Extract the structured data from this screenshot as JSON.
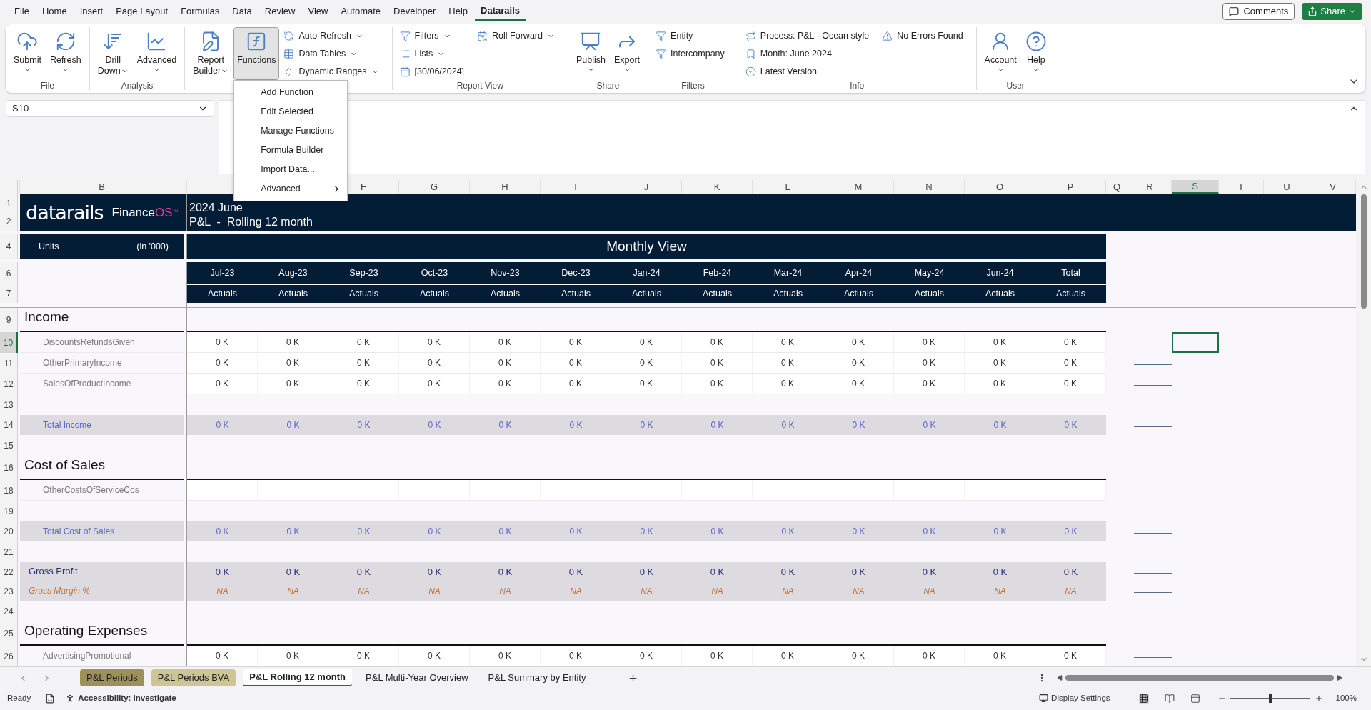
{
  "menu_tabs": [
    {
      "label": "File",
      "selected": false
    },
    {
      "label": "Home",
      "selected": false
    },
    {
      "label": "Insert",
      "selected": false
    },
    {
      "label": "Page Layout",
      "selected": false
    },
    {
      "label": "Formulas",
      "selected": false
    },
    {
      "label": "Data",
      "selected": false
    },
    {
      "label": "Review",
      "selected": false
    },
    {
      "label": "View",
      "selected": false
    },
    {
      "label": "Automate",
      "selected": false
    },
    {
      "label": "Developer",
      "selected": false
    },
    {
      "label": "Help",
      "selected": false
    },
    {
      "label": "Datarails",
      "selected": true
    }
  ],
  "top_buttons": {
    "comments": "Comments",
    "share": "Share"
  },
  "ribbon": {
    "groups": [
      {
        "label": "File",
        "items": [
          {
            "kind": "large",
            "lines": [
              "Submit"
            ],
            "dropdown": true,
            "pressed": false
          },
          {
            "kind": "large",
            "lines": [
              "Refresh"
            ],
            "dropdown": true,
            "pressed": false
          }
        ]
      },
      {
        "label": "Analysis",
        "items": [
          {
            "kind": "large",
            "lines": [
              "Drill",
              "Down"
            ],
            "dropdown": true,
            "pressed": false
          },
          {
            "kind": "large",
            "lines": [
              "Advanced"
            ],
            "dropdown": true,
            "pressed": false
          }
        ]
      },
      {
        "items": [
          {
            "kind": "large",
            "lines": [
              "Report",
              "Builder"
            ],
            "dropdown": true,
            "pressed": false
          },
          {
            "kind": "large",
            "lines": [
              "Functions"
            ],
            "dropdown": false,
            "pressed": true
          },
          {
            "kind": "column",
            "entries": [
              {
                "label": "Auto-Refresh",
                "dropdown": true
              },
              {
                "label": "Data Tables",
                "dropdown": true
              },
              {
                "label": "Dynamic Ranges",
                "dropdown": true
              }
            ]
          }
        ]
      },
      {
        "label": "Report View",
        "items": [
          {
            "kind": "column",
            "entries": [
              {
                "label": "Filters",
                "dropdown": true
              },
              {
                "label": "Lists",
                "dropdown": true
              },
              {
                "label": "[30/06/2024]",
                "dropdown": false
              }
            ]
          },
          {
            "kind": "column",
            "entries": [
              {
                "label": "Roll Forward",
                "dropdown": true
              }
            ]
          }
        ]
      },
      {
        "label": "Share",
        "items": [
          {
            "kind": "large",
            "lines": [
              "Publish"
            ],
            "dropdown": true,
            "pressed": false
          },
          {
            "kind": "large",
            "lines": [
              "Export"
            ],
            "dropdown": true,
            "pressed": false
          }
        ]
      },
      {
        "label": "Filters",
        "items": [
          {
            "kind": "column",
            "entries": [
              {
                "label": "Entity",
                "dropdown": false
              },
              {
                "label": "Intercompany",
                "dropdown": false
              }
            ]
          }
        ]
      },
      {
        "label": "Info",
        "items": [
          {
            "kind": "column",
            "entries": [
              {
                "label": "Process: P&L - Ocean style",
                "dropdown": false
              },
              {
                "label": "Month: June 2024",
                "dropdown": false
              },
              {
                "label": "Latest Version",
                "dropdown": false
              }
            ]
          },
          {
            "kind": "column",
            "entries": [
              {
                "label": "No Errors Found",
                "dropdown": false
              }
            ]
          }
        ]
      },
      {
        "label": "User",
        "items": [
          {
            "kind": "large",
            "lines": [
              "Account"
            ],
            "dropdown": true,
            "pressed": false
          },
          {
            "kind": "large",
            "lines": [
              "Help"
            ],
            "dropdown": true,
            "pressed": false
          }
        ]
      }
    ]
  },
  "functions_menu": [
    {
      "label": "Add Function",
      "submenu": false
    },
    {
      "label": "Edit Selected",
      "submenu": false
    },
    {
      "label": "Manage Functions",
      "submenu": false
    },
    {
      "label": "Formula Builder",
      "submenu": false
    },
    {
      "label": "Import Data...",
      "submenu": false
    },
    {
      "label": "Advanced",
      "submenu": true
    }
  ],
  "name_box": "S10",
  "sheet": {
    "columns": [
      {},
      {
        "label": "B",
        "selected": false
      },
      {},
      {},
      {},
      {
        "label": "F",
        "selected": false
      },
      {
        "label": "G",
        "selected": false
      },
      {
        "label": "H",
        "selected": false
      },
      {
        "label": "I",
        "selected": false
      },
      {
        "label": "J",
        "selected": false
      },
      {
        "label": "K",
        "selected": false
      },
      {
        "label": "L",
        "selected": false
      },
      {
        "label": "M",
        "selected": false
      },
      {
        "label": "N",
        "selected": false
      },
      {
        "label": "O",
        "selected": false
      },
      {
        "label": "P",
        "selected": false
      },
      {
        "label": "Q",
        "selected": false
      },
      {
        "label": "R",
        "selected": false
      },
      {
        "label": "S",
        "selected": true
      },
      {
        "label": "T",
        "selected": false
      },
      {
        "label": "U",
        "selected": false
      },
      {
        "label": "V",
        "selected": false
      }
    ],
    "logo": {
      "brand": "datarails",
      "product": "Finance",
      "product_accent": "OS",
      "trademark": "™"
    },
    "title_rows": [
      {
        "number": "1",
        "text": "2024 June"
      },
      {
        "number": "2",
        "text": "P&L  -  Rolling 12 month"
      }
    ],
    "units_row": {
      "number": "4",
      "label": "Units",
      "scale": "(in '000)",
      "title": "Monthly View"
    },
    "period_row": {
      "number": "6",
      "values": [
        "Jul-23",
        "Aug-23",
        "Sep-23",
        "Oct-23",
        "Nov-23",
        "Dec-23",
        "Jan-24",
        "Feb-24",
        "Mar-24",
        "Apr-24",
        "May-24",
        "Jun-24",
        "Total"
      ]
    },
    "scenario_row": {
      "number": "7",
      "values": [
        "Actuals",
        "Actuals",
        "Actuals",
        "Actuals",
        "Actuals",
        "Actuals",
        "Actuals",
        "Actuals",
        "Actuals",
        "Actuals",
        "Actuals",
        "Actuals",
        "Actuals"
      ]
    },
    "rows": [
      {
        "number": "9",
        "kind": "section",
        "label": "Income",
        "selected": false
      },
      {
        "number": "10",
        "kind": "line",
        "label": "DiscountsRefundsGiven",
        "selected": true,
        "marker": true,
        "values": [
          "0 K",
          "0 K",
          "0 K",
          "0 K",
          "0 K",
          "0 K",
          "0 K",
          "0 K",
          "0 K",
          "0 K",
          "0 K",
          "0 K",
          "0 K"
        ]
      },
      {
        "number": "11",
        "kind": "line",
        "label": "OtherPrimaryIncome",
        "selected": false,
        "marker": true,
        "values": [
          "0 K",
          "0 K",
          "0 K",
          "0 K",
          "0 K",
          "0 K",
          "0 K",
          "0 K",
          "0 K",
          "0 K",
          "0 K",
          "0 K",
          "0 K"
        ]
      },
      {
        "number": "12",
        "kind": "line",
        "label": "SalesOfProductIncome",
        "selected": false,
        "marker": true,
        "values": [
          "0 K",
          "0 K",
          "0 K",
          "0 K",
          "0 K",
          "0 K",
          "0 K",
          "0 K",
          "0 K",
          "0 K",
          "0 K",
          "0 K",
          "0 K"
        ]
      },
      {
        "number": "13",
        "kind": "blank",
        "selected": false
      },
      {
        "number": "14",
        "kind": "total",
        "label": "Total Income",
        "selected": false,
        "marker": true,
        "values": [
          "0 K",
          "0 K",
          "0 K",
          "0 K",
          "0 K",
          "0 K",
          "0 K",
          "0 K",
          "0 K",
          "0 K",
          "0 K",
          "0 K",
          "0 K"
        ]
      },
      {
        "number": "15",
        "kind": "blank",
        "selected": false
      },
      {
        "number": "16",
        "kind": "section",
        "label": "Cost of Sales",
        "selected": false
      },
      {
        "number": "18",
        "kind": "line",
        "label": "OtherCostsOfServiceCos",
        "selected": false
      },
      {
        "number": "19",
        "kind": "blank",
        "selected": false
      },
      {
        "number": "20",
        "kind": "total",
        "label": "Total Cost of Sales",
        "selected": false,
        "marker": true,
        "values": [
          "0 K",
          "0 K",
          "0 K",
          "0 K",
          "0 K",
          "0 K",
          "0 K",
          "0 K",
          "0 K",
          "0 K",
          "0 K",
          "0 K",
          "0 K"
        ]
      },
      {
        "number": "21",
        "kind": "blank",
        "selected": false
      },
      {
        "number": "22",
        "kind": "gross",
        "label": "Gross Profit",
        "selected": false,
        "marker": true,
        "values": [
          "0 K",
          "0 K",
          "0 K",
          "0 K",
          "0 K",
          "0 K",
          "0 K",
          "0 K",
          "0 K",
          "0 K",
          "0 K",
          "0 K",
          "0 K"
        ]
      },
      {
        "number": "23",
        "kind": "margin",
        "label": "Gross Margin %",
        "selected": false,
        "marker": true,
        "values": [
          "NA",
          "NA",
          "NA",
          "NA",
          "NA",
          "NA",
          "NA",
          "NA",
          "NA",
          "NA",
          "NA",
          "NA",
          "NA"
        ]
      },
      {
        "number": "24",
        "kind": "blank",
        "selected": false
      },
      {
        "number": "25",
        "kind": "section",
        "label": "Operating Expenses",
        "selected": false
      },
      {
        "number": "26",
        "kind": "line",
        "label": "AdvertisingPromotional",
        "selected": false,
        "marker": true,
        "values": [
          "0 K",
          "0 K",
          "0 K",
          "0 K",
          "0 K",
          "0 K",
          "0 K",
          "0 K",
          "0 K",
          "0 K",
          "0 K",
          "0 K",
          "0 K"
        ]
      }
    ]
  },
  "sheet_tabs": [
    {
      "label": "P&L Periods",
      "selected": false,
      "color": "#9c9259"
    },
    {
      "label": "P&L Periods BVA",
      "selected": false,
      "color": "#cdc596"
    },
    {
      "label": "P&L Rolling 12 month",
      "selected": true
    },
    {
      "label": "P&L Multi-Year Overview",
      "selected": false
    },
    {
      "label": "P&L Summary by Entity",
      "selected": false
    }
  ],
  "status_bar": {
    "ready": "Ready",
    "accessibility": "Accessibility: Investigate",
    "display_settings": "Display Settings",
    "views": [
      {
        "selected": true
      },
      {
        "selected": false
      },
      {
        "selected": false
      }
    ],
    "zoom": {
      "level": 0.5,
      "reading": "100%"
    }
  }
}
